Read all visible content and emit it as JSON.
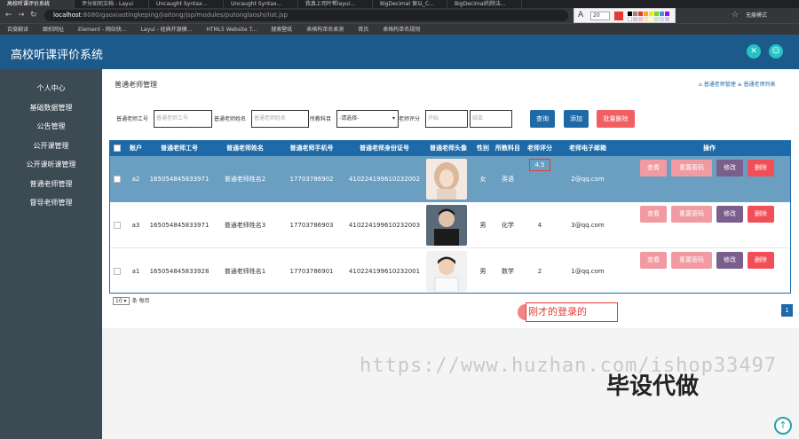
{
  "browser": {
    "tabs": [
      "高校听课评价系统",
      "评分如何文档 - Layui",
      "Uncaught Syntax...",
      "Uncaught Syntax...",
      "我真上司叶帮layui...",
      "BigDecimal 保以_C...",
      "BigDecimal的除法..."
    ],
    "url_host": "localhost",
    "url_path": ":8080/gaoxiaotingkeping/jiaitong/jsp/modules/putonglaoshi/list.jsp",
    "annot_size": "20",
    "profile": "无痕模式",
    "bookmarks": [
      "百度翻译",
      "跟拍网址",
      "Element - 网站快...",
      "Layui - 经典开源模...",
      "HTML5 Website T...",
      "搜索壁纸",
      "表格构单名表测",
      "首页",
      "表格构单名规则"
    ]
  },
  "header": {
    "title": "高校听课评价系统",
    "icon_close": "✕",
    "icon_user": "☺"
  },
  "sidebar": {
    "items": [
      "个人中心",
      "基础数据管理",
      "公告管理",
      "公开课管理",
      "公开课听课管理",
      "普通老师管理",
      "督导老师管理"
    ]
  },
  "page": {
    "title": "普通老师管理",
    "breadcrumb": "⌂ 普通老师管理 ≡ 普通老师列表"
  },
  "search": {
    "label_id": "普通老师工号",
    "ph_id": "普通老师工号",
    "label_name": "普通老师姓名",
    "ph_name": "普通老师姓名",
    "label_subject": "所教科目",
    "subject_value": "-请选择-",
    "label_score": "老师评分",
    "ph_start": "开始",
    "ph_end": "结束",
    "btn_search": "查询",
    "btn_add": "添加",
    "btn_batch_delete": "批量删除"
  },
  "table": {
    "headers": [
      "账户",
      "普通老师工号",
      "普通老师姓名",
      "普通老师手机号",
      "普通老师身份证号",
      "普通老师头像",
      "性别",
      "所教科目",
      "老师评分",
      "老师电子邮箱",
      "操作"
    ],
    "rows": [
      {
        "account": "a2",
        "id": "165054845833971",
        "name": "普通老师姓名2",
        "phone": "17703786902",
        "idcard": "410224199610232002",
        "gender": "女",
        "subject": "英语",
        "score": "4.5",
        "email": "2@qq.com"
      },
      {
        "account": "a3",
        "id": "165054845833971",
        "name": "普通老师姓名3",
        "phone": "17703786903",
        "idcard": "410224199610232003",
        "gender": "男",
        "subject": "化学",
        "score": "4",
        "email": "3@qq.com"
      },
      {
        "account": "a1",
        "id": "165054845833928",
        "name": "普通老师姓名1",
        "phone": "17703786901",
        "idcard": "410224199610232001",
        "gender": "男",
        "subject": "数学",
        "score": "2",
        "email": "1@qq.com"
      }
    ],
    "actions": {
      "view": "查看",
      "reset": "重置密码",
      "edit": "修改",
      "delete": "删除"
    }
  },
  "pager": {
    "page_size": "10 ▾",
    "per_page": "条 每页",
    "current_page": "1"
  },
  "annotation": {
    "text": "刚才的登录的"
  },
  "watermark": {
    "url": "https://www.huzhan.com/ishop33497",
    "text": "毕设代做"
  },
  "colors": {
    "header": "#1d5a8c",
    "sidebar": "#3c4a54",
    "primary": "#1e6aa8",
    "danger": "#f24e57"
  }
}
